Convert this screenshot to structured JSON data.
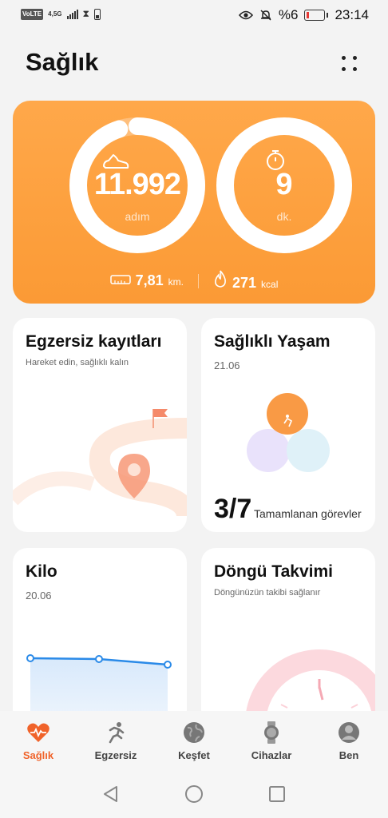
{
  "status_bar": {
    "left_badge": "VoLTE",
    "network": "4,5G",
    "battery_percent": "%6",
    "time": "23:14"
  },
  "header": {
    "title": "Sağlık"
  },
  "activity": {
    "steps_value": "11.992",
    "steps_unit": "adım",
    "steps_progress": 0.95,
    "minutes_value": "9",
    "minutes_unit": "dk.",
    "minutes_progress": 0.3,
    "distance_value": "7,81",
    "distance_unit": "km.",
    "calories_value": "271",
    "calories_unit": "kcal"
  },
  "cards": {
    "exercise": {
      "title": "Egzersiz kayıtları",
      "subtitle": "Hareket edin, sağlıklı kalın"
    },
    "healthy_living": {
      "title": "Sağlıklı Yaşam",
      "date": "21.06",
      "tasks_done": "3/7",
      "tasks_label": "Tamamlanan görevler"
    },
    "weight": {
      "title": "Kilo",
      "date": "20.06"
    },
    "cycle": {
      "title": "Döngü Takvimi",
      "subtitle": "Döngünüzün takibi sağlanır"
    }
  },
  "bottom_nav": [
    {
      "label": "Sağlık",
      "icon": "heart-pulse-icon",
      "active": true
    },
    {
      "label": "Egzersiz",
      "icon": "running-icon",
      "active": false
    },
    {
      "label": "Keşfet",
      "icon": "globe-icon",
      "active": false
    },
    {
      "label": "Cihazlar",
      "icon": "watch-icon",
      "active": false
    },
    {
      "label": "Ben",
      "icon": "user-icon",
      "active": false
    }
  ],
  "colors": {
    "accent": "#f0632a",
    "hero_orange": "#fb9a35",
    "line_blue": "#2a8ae8"
  }
}
